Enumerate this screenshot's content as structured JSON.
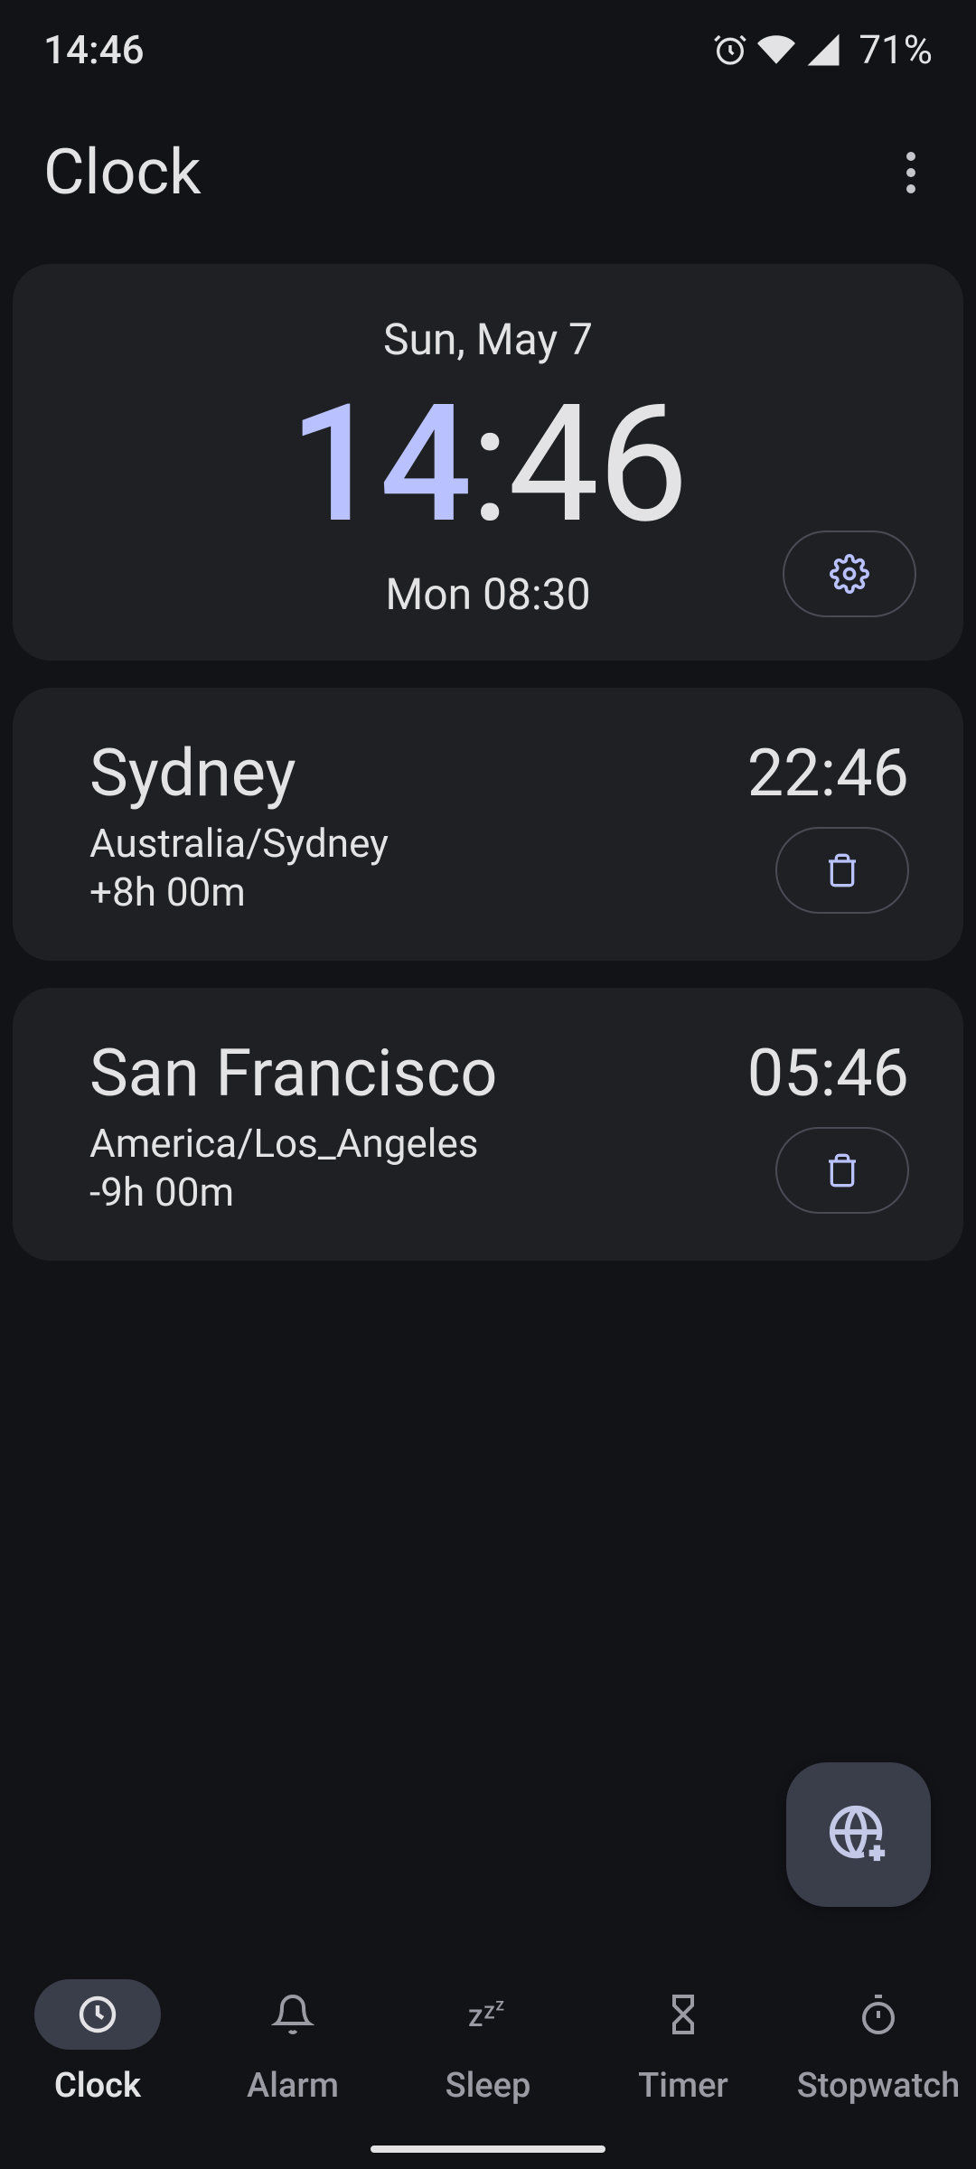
{
  "statusbar": {
    "time": "14:46",
    "battery": "71%"
  },
  "header": {
    "title": "Clock"
  },
  "main_clock": {
    "date": "Sun, May 7",
    "hours": "14",
    "mins": "46",
    "next_alarm": "Mon 08:30"
  },
  "cities": [
    {
      "name": "Sydney",
      "tz": "Australia/Sydney",
      "offset": "+8h 00m",
      "time": "22:46"
    },
    {
      "name": "San Francisco",
      "tz": "America/Los_Angeles",
      "offset": "-9h 00m",
      "time": "05:46"
    }
  ],
  "nav": {
    "items": [
      {
        "label": "Clock",
        "active": true
      },
      {
        "label": "Alarm",
        "active": false
      },
      {
        "label": "Sleep",
        "active": false
      },
      {
        "label": "Timer",
        "active": false
      },
      {
        "label": "Stopwatch",
        "active": false
      }
    ]
  }
}
